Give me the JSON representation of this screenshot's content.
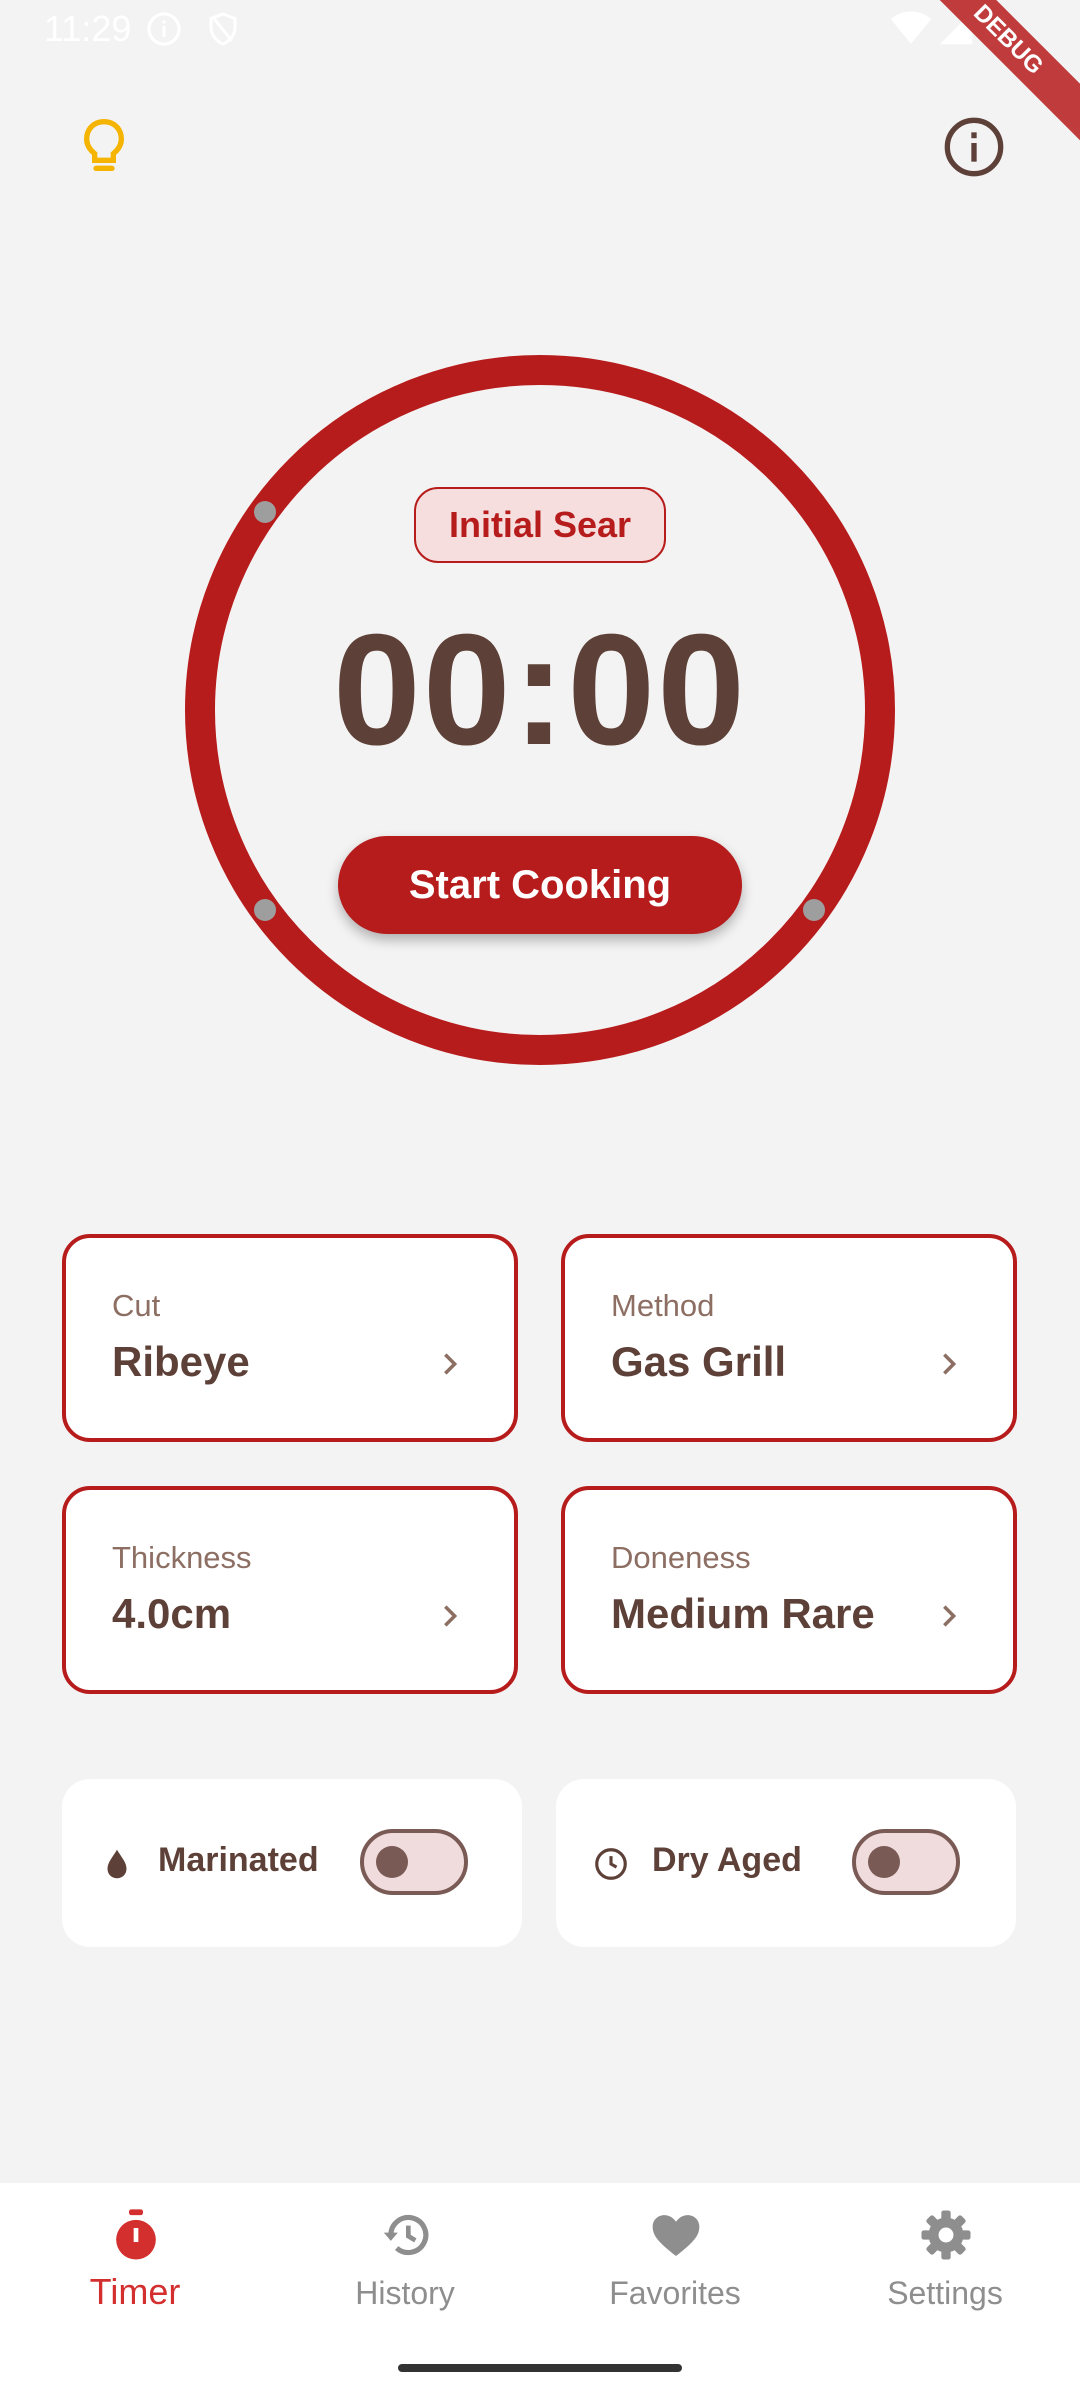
{
  "status_bar": {
    "time": "11:29",
    "debug_label": "DEBUG",
    "icons": [
      "info-icon",
      "shield-icon",
      "wifi-icon",
      "cell-signal-icon",
      "battery-icon"
    ]
  },
  "header": {
    "hint_icon": "lightbulb-icon",
    "info_icon": "info-circle-icon",
    "hint_color": "#F4B400"
  },
  "timer": {
    "phase": "Initial Sear",
    "time": "00:00",
    "start_label": "Start Cooking",
    "ring_color": "#B71C1C",
    "progress": 0
  },
  "options": [
    {
      "label": "Cut",
      "value": "Ribeye"
    },
    {
      "label": "Method",
      "value": "Gas Grill"
    },
    {
      "label": "Thickness",
      "value": "4.0cm"
    },
    {
      "label": "Doneness",
      "value": "Medium Rare"
    }
  ],
  "toggles": [
    {
      "label": "Marinated",
      "icon": "drop-icon",
      "on": false
    },
    {
      "label": "Dry Aged",
      "icon": "clock-icon",
      "on": false
    }
  ],
  "nav": {
    "items": [
      {
        "label": "Timer",
        "icon": "timer-icon",
        "active": true
      },
      {
        "label": "History",
        "icon": "history-icon",
        "active": false
      },
      {
        "label": "Favorites",
        "icon": "heart-icon",
        "active": false
      },
      {
        "label": "Settings",
        "icon": "gear-icon",
        "active": false
      }
    ],
    "active_color": "#D32F2F",
    "inactive_color": "#8E8E8E"
  },
  "colors": {
    "accent": "#B71C1C",
    "text_brown": "#5D4037",
    "background": "#F4F3F3"
  }
}
